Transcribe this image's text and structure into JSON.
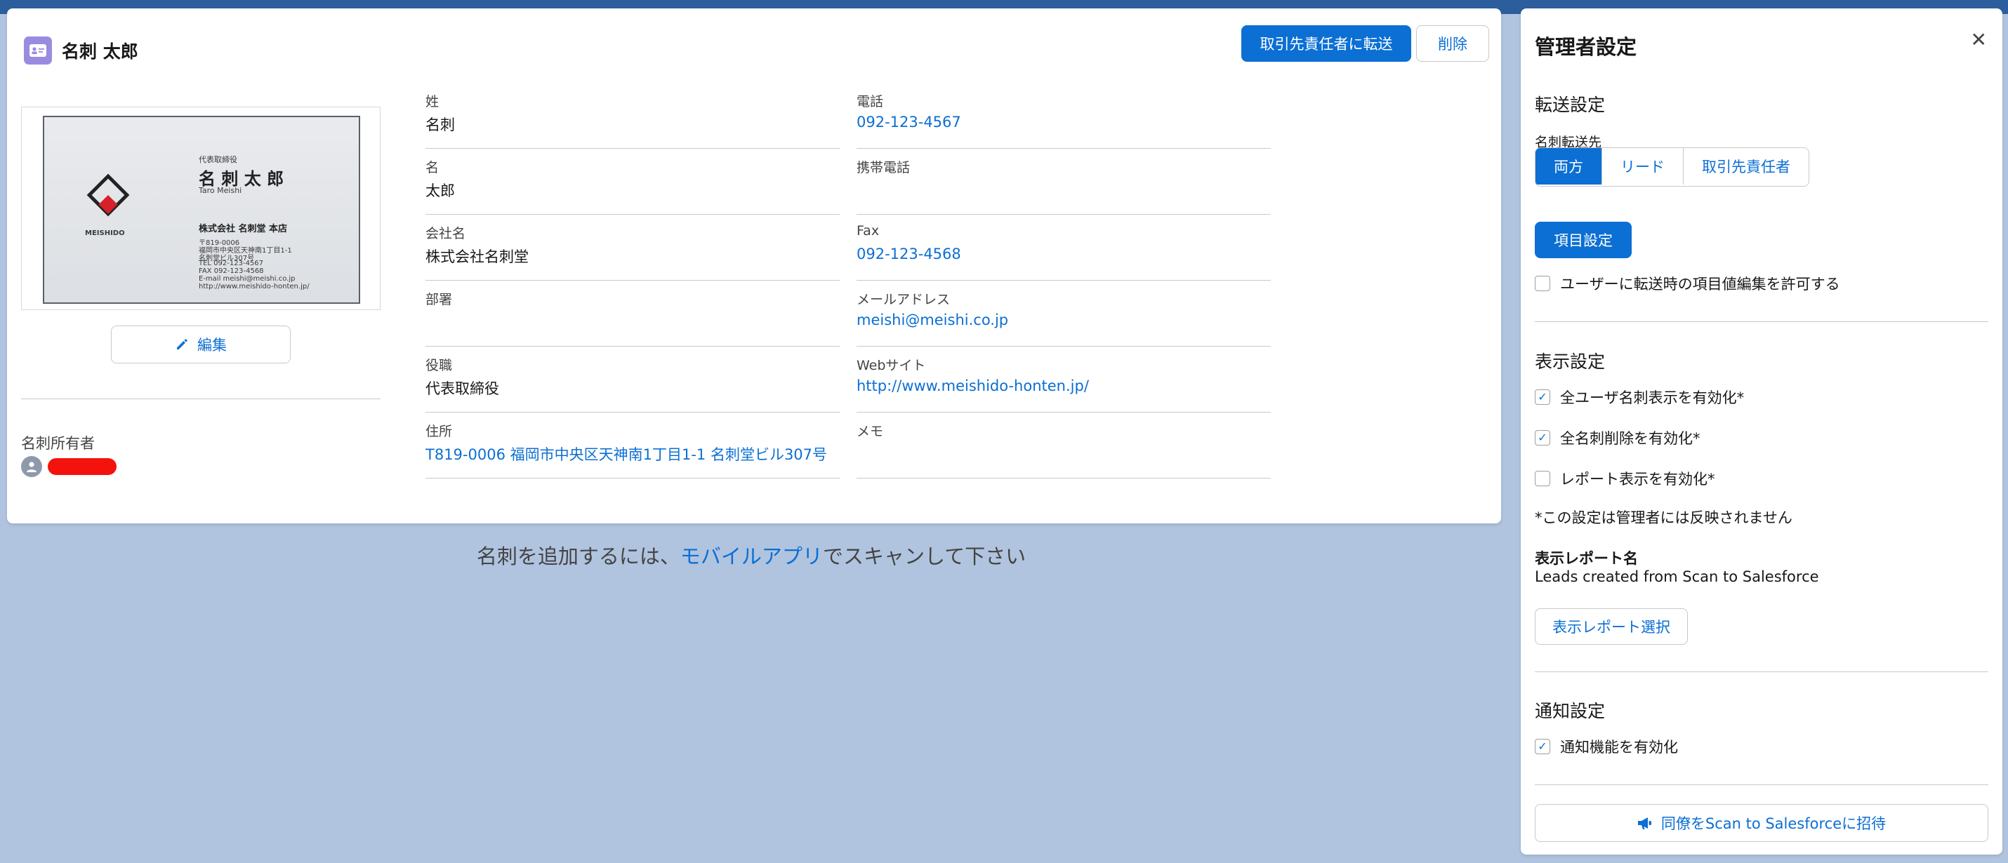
{
  "record": {
    "title": "名刺 太郎",
    "convert_button": "取引先責任者に転送",
    "delete_button": "削除",
    "edit_button": "編集",
    "owner_label": "名刺所有者",
    "owner_name": "redacted"
  },
  "business_card": {
    "role": "代表取締役",
    "name": "名 刺 太 郎",
    "romaji": "Taro Meishi",
    "logo": "MDH",
    "logo_sub": "MEISHIDO",
    "company": "株式会社 名刺堂 本店",
    "lines": [
      "〒819-0006",
      "福岡市中央区天神南1丁目1-1",
      "名刺堂ビル307号",
      "TEL 092-123-4567",
      "FAX 092-123-4568",
      "E-mail meishi@meishi.co.jp",
      "http://www.meishido-honten.jp/"
    ]
  },
  "fields_left": [
    {
      "label": "姓",
      "value": "名刺",
      "link": false
    },
    {
      "label": "名",
      "value": "太郎",
      "link": false
    },
    {
      "label": "会社名",
      "value": "株式会社名刺堂",
      "link": false
    },
    {
      "label": "部署",
      "value": "",
      "link": false
    },
    {
      "label": "役職",
      "value": "代表取締役",
      "link": false
    },
    {
      "label": "住所",
      "value": "T819-0006 福岡市中央区天神南1丁目1-1 名刺堂ビル307号",
      "link": true
    }
  ],
  "fields_right": [
    {
      "label": "電話",
      "value": "092-123-4567",
      "link": true
    },
    {
      "label": "携帯電話",
      "value": "",
      "link": false
    },
    {
      "label": "Fax",
      "value": "092-123-4568",
      "link": true
    },
    {
      "label": "メールアドレス",
      "value": "meishi@meishi.co.jp",
      "link": true
    },
    {
      "label": "Webサイト",
      "value": "http://www.meishido-honten.jp/",
      "link": true
    },
    {
      "label": "メモ",
      "value": "",
      "link": false
    }
  ],
  "hint": {
    "before": "名刺を追加するには、",
    "link": "モバイルアプリ",
    "after": "でスキャンして下さい"
  },
  "admin": {
    "title": "管理者設定",
    "transfer_section": "転送設定",
    "transfer_target_label": "名刺転送先",
    "segments": [
      "両方",
      "リード",
      "取引先責任者"
    ],
    "active_segment": "両方",
    "field_settings_button": "項目設定",
    "allow_edit_label": "ユーザーに転送時の項目値編集を許可する",
    "allow_edit_checked": false,
    "display_section": "表示設定",
    "display_options": [
      {
        "label": "全ユーザ名刺表示を有効化*",
        "checked": true
      },
      {
        "label": "全名刺削除を有効化*",
        "checked": true
      },
      {
        "label": "レポート表示を有効化*",
        "checked": false
      }
    ],
    "display_note": "*この設定は管理者には反映されません",
    "report_name_label": "表示レポート名",
    "report_name_value": "Leads created from Scan to Salesforce",
    "report_select_button": "表示レポート選択",
    "notify_section": "通知設定",
    "notify_label": "通知機能を有効化",
    "notify_checked": true,
    "invite_button": "同僚をScan to Salesforceに招待"
  },
  "colors": {
    "brand": "#0b6fd4",
    "background": "#b0c4df",
    "card_icon": "#9b8be0",
    "redaction": "#f3130c"
  }
}
